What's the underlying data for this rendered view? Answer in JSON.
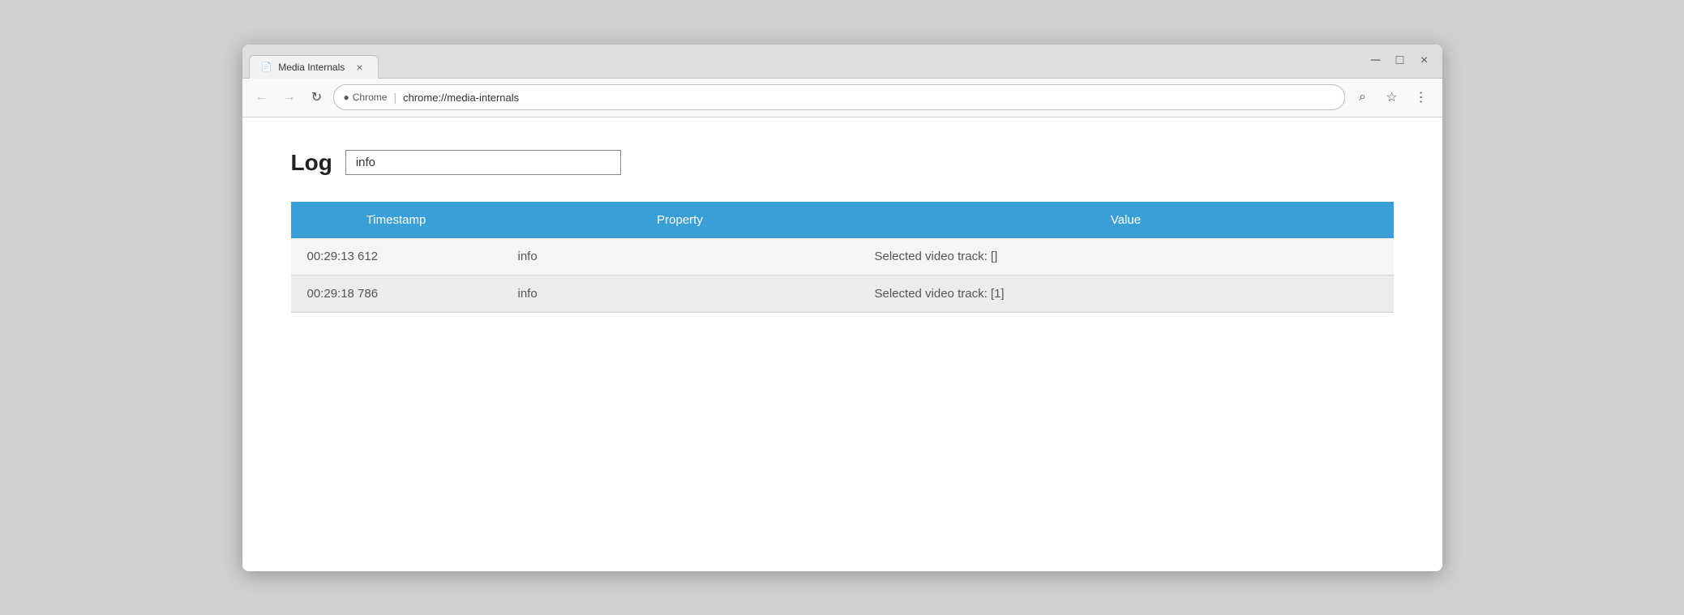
{
  "window": {
    "title": "Media Internals",
    "close_label": "×",
    "minimize_label": "─",
    "maximize_label": "□"
  },
  "tab": {
    "icon": "📄",
    "title": "Media Internals",
    "close": "×"
  },
  "addressbar": {
    "secure_icon": "🔒",
    "secure_label": "Chrome",
    "url": "chrome://media-internals"
  },
  "toolbar": {
    "search_icon": "⌕",
    "star_icon": "☆",
    "menu_icon": "⋮"
  },
  "log": {
    "label": "Log",
    "input_value": "info",
    "input_placeholder": ""
  },
  "table": {
    "headers": [
      "Timestamp",
      "Property",
      "Value"
    ],
    "rows": [
      {
        "timestamp": "00:29:13 612",
        "property": "info",
        "value": "Selected video track: []"
      },
      {
        "timestamp": "00:29:18 786",
        "property": "info",
        "value": "Selected video track: [1]"
      }
    ]
  }
}
